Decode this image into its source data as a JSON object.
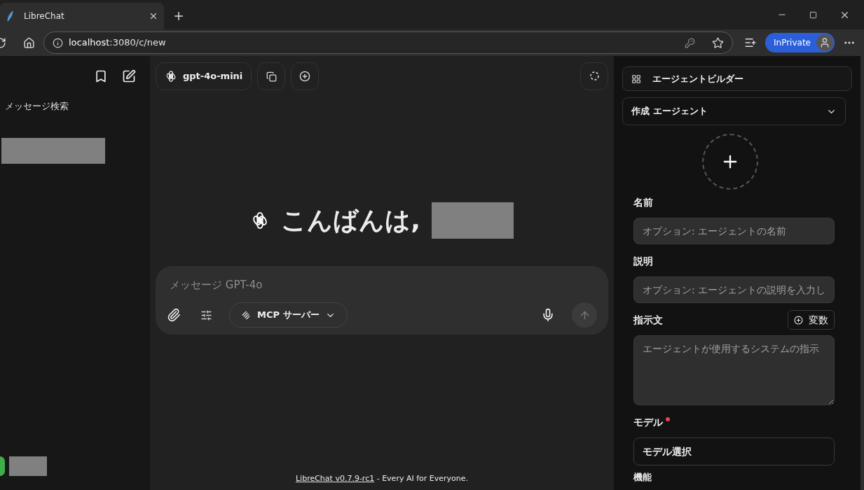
{
  "browser": {
    "tab_title": "LibreChat",
    "url_host": "localhost",
    "url_path": ":3080/c/new",
    "profile_label": "InPrivate"
  },
  "sidebar": {
    "search_label": "メッセージ検索"
  },
  "chat": {
    "model": "gpt-4o-mini",
    "greeting": "こんばんは,",
    "input_placeholder": "メッセージ GPT-4o",
    "mcp_label": "MCP サーバー",
    "footer_link": "LibreChat v0.7.9-rc1",
    "footer_text": " - Every AI for Everyone."
  },
  "agent_panel": {
    "title": "エージェントビルダー",
    "selector": "作成 エージェント",
    "fields": [
      {
        "kind": "input",
        "label": "名前",
        "placeholder": "オプション: エージェントの名前",
        "required": false
      },
      {
        "kind": "input",
        "label": "説明",
        "placeholder": "オプション: エージェントの説明を入力し",
        "required": false
      },
      {
        "kind": "textarea",
        "label": "指示文",
        "placeholder": "エージェントが使用するシステムの指示",
        "required": false,
        "action": "変数"
      },
      {
        "kind": "select",
        "label": "モデル",
        "value": "モデル選択",
        "required": true
      }
    ],
    "next_label": "機能"
  }
}
